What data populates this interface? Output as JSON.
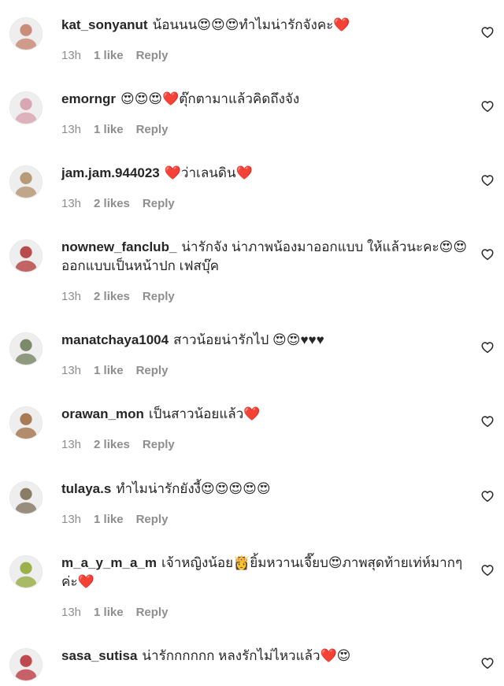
{
  "comments": [
    {
      "username": "kat_sonyanut",
      "text": "น้อนนน😍😍😍ทำไมน่ารักจังคะ❤️",
      "time": "13h",
      "likes": "1 like",
      "reply": "Reply",
      "avatar_color": "#c98d7a"
    },
    {
      "username": "emorngr",
      "text": "😍😍😍❤️ตุ๊กตามาแล้วคิดถึงจัง",
      "time": "13h",
      "likes": "1 like",
      "reply": "Reply",
      "avatar_color": "#d9a7b3"
    },
    {
      "username": "jam.jam.944023",
      "text": "❤️ว่าเลนดิน❤️",
      "time": "13h",
      "likes": "2 likes",
      "reply": "Reply",
      "avatar_color": "#b79a78"
    },
    {
      "username": "nownew_fanclub_",
      "text": "น่ารักจัง น่าภาพน้องมาออกแบบ ให้แล้วนะคะ😍😍ออกแบบเป็นหน้าปก เฟสบุ๊ค",
      "time": "13h",
      "likes": "2 likes",
      "reply": "Reply",
      "avatar_color": "#b84b4b"
    },
    {
      "username": "manatchaya1004",
      "text": "สาวน้อยน่ารักไป 😍😍♥♥♥",
      "time": "13h",
      "likes": "1 like",
      "reply": "Reply",
      "avatar_color": "#7d8a6a"
    },
    {
      "username": "orawan_mon",
      "text": "เป็นสาวน้อยแล้ว❤️",
      "time": "13h",
      "likes": "2 likes",
      "reply": "Reply",
      "avatar_color": "#a87a55"
    },
    {
      "username": "tulaya.s",
      "text": "ทำไมน่ารักยังงี้😍😍😍😍😍",
      "time": "13h",
      "likes": "1 like",
      "reply": "Reply",
      "avatar_color": "#8a7d68"
    },
    {
      "username": "m_a_y_m_a_m",
      "text": "เจ้าหญิงน้อย👸ยิ้มหวานเจี๊ยบ😍ภาพสุดท้ายเท่ห์มากๆค่ะ❤️",
      "time": "13h",
      "likes": "1 like",
      "reply": "Reply",
      "avatar_color": "#9bb04a"
    },
    {
      "username": "sasa_sutisa",
      "text": "น่ารักกกกกก หลงรักไม่ไหวแล้ว❤️😍",
      "time": "",
      "likes": "",
      "reply": "",
      "avatar_color": "#c0484f"
    }
  ],
  "icons": {
    "like": "heart-outline-icon"
  },
  "colors": {
    "meta": "#8e8e8e",
    "text": "#262626"
  }
}
